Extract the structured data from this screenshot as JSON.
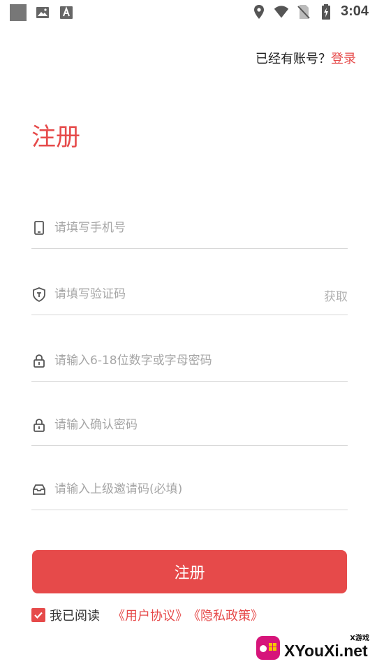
{
  "status_bar": {
    "time": "3:04"
  },
  "header": {
    "login_hint": "已经有账号？",
    "login_link": "登录"
  },
  "title": "注册",
  "form": {
    "phone": {
      "placeholder": "请填写手机号",
      "value": ""
    },
    "code": {
      "placeholder": "请填写验证码",
      "value": "",
      "get_code_label": "获取"
    },
    "password": {
      "placeholder": "请输入6-18位数字或字母密码",
      "value": ""
    },
    "confirm_password": {
      "placeholder": "请输入确认密码",
      "value": ""
    },
    "invite_code": {
      "placeholder": "请输入上级邀请码(必填)",
      "value": ""
    }
  },
  "submit_label": "注册",
  "agreement": {
    "checked": true,
    "prefix": "我已阅读",
    "user_agreement": "《用户协议》",
    "privacy_policy": "《隐私政策》"
  },
  "watermark": {
    "text": "XYouXi.net",
    "small": "X游戏"
  },
  "colors": {
    "accent": "#e64a4a",
    "placeholder": "#a6a6a6",
    "divider": "#d8d8d8"
  }
}
